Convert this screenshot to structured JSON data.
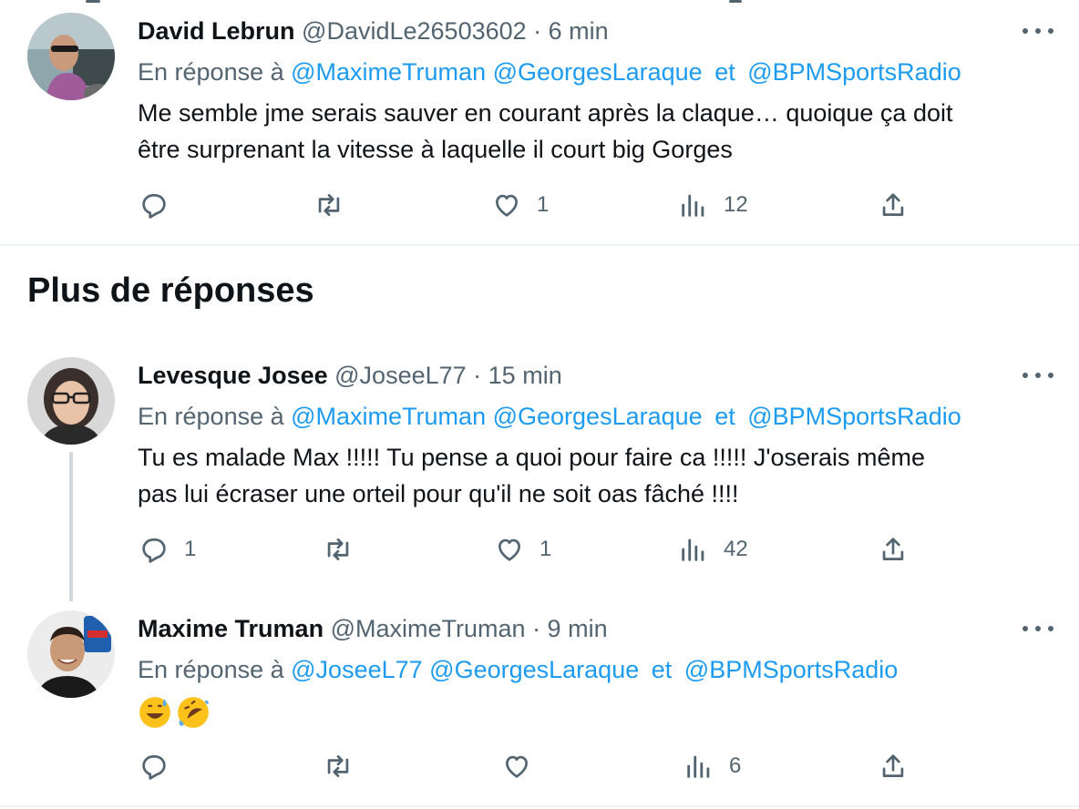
{
  "tweets": [
    {
      "name": "David Lebrun",
      "handle": "@DavidLe26503602",
      "time": "· 6 min",
      "reply_prefix": "En réponse à",
      "mentions": [
        "@MaximeTruman",
        "@GeorgesLaraque",
        "@BPMSportsRadio"
      ],
      "and": "et",
      "text_line1": "Me semble jme serais sauver en courant après la claque… quoique ça doit",
      "text_line2": "être surprenant la vitesse à laquelle il court big Gorges",
      "replies": "",
      "retweets": "",
      "likes": "1",
      "views": "12"
    },
    {
      "name": "Levesque Josee",
      "handle": "@JoseeL77",
      "time": "· 15 min",
      "reply_prefix": "En réponse à",
      "mentions": [
        "@MaximeTruman",
        "@GeorgesLaraque",
        "@BPMSportsRadio"
      ],
      "and": "et",
      "text_line1": "Tu es malade Max !!!!! Tu pense a quoi pour faire ca !!!!! J'oserais même",
      "text_line2": "pas lui écraser une orteil pour qu'il ne soit oas fâché  !!!!",
      "replies": "1",
      "retweets": "",
      "likes": "1",
      "views": "42"
    },
    {
      "name": "Maxime Truman",
      "handle": "@MaximeTruman",
      "time": "· 9 min",
      "reply_prefix": "En réponse à",
      "mentions": [
        "@JoseeL77",
        "@GeorgesLaraque",
        "@BPMSportsRadio"
      ],
      "and": "et",
      "emojis": [
        "grinning-face-with-sweat",
        "rolling-on-the-floor-laughing"
      ],
      "replies": "",
      "retweets": "",
      "likes": "",
      "views": "6"
    }
  ],
  "section_title": "Plus de réponses",
  "colors": {
    "link": "#1d9bf0",
    "muted": "#536471",
    "text": "#0f1419",
    "divider": "#eff3f4",
    "thread": "#cfd9de"
  },
  "icons": [
    "reply-icon",
    "retweet-icon",
    "like-icon",
    "views-icon",
    "share-icon",
    "more-icon"
  ]
}
